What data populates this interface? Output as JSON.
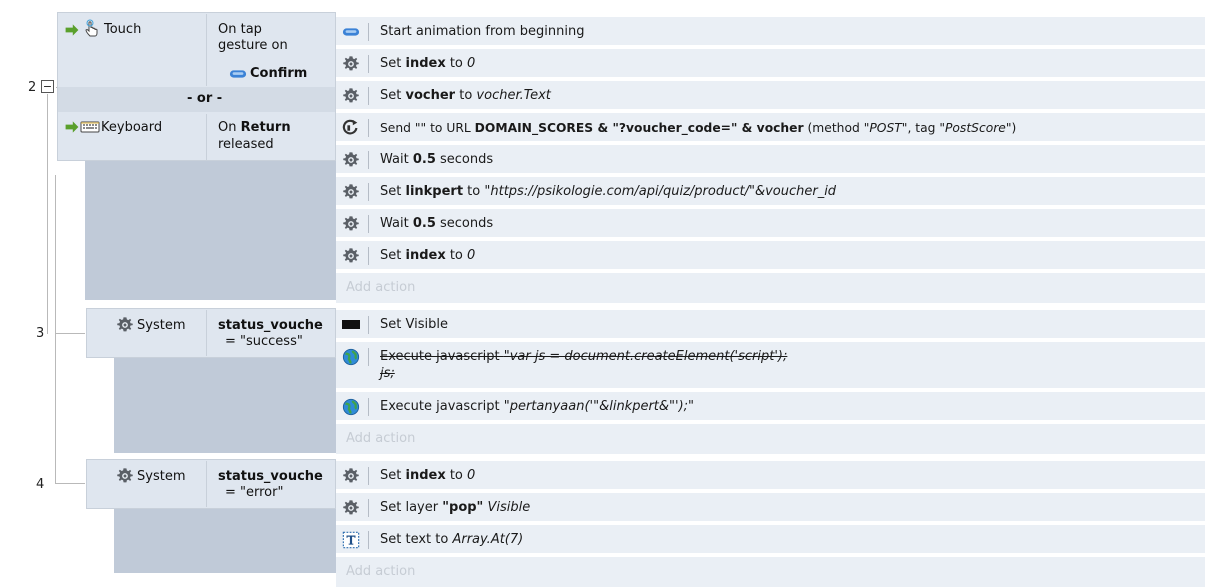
{
  "events": [
    {
      "number": "2",
      "collapse_glyph": "−",
      "conditions": [
        {
          "object": "Touch",
          "icon": "touch-icon",
          "text": "On tap gesture on",
          "target": "Confirm",
          "target_icon": "sprite-button-icon"
        },
        {
          "object": "Keyboard",
          "icon": "keyboard-icon",
          "text_prefix": "On",
          "key": "Return",
          "text_suffix": "released"
        }
      ],
      "or_label": "- or -",
      "actions": [
        {
          "icon": "sprite-button-icon",
          "segments": [
            "Start animation from beginning"
          ]
        },
        {
          "icon": "gear-icon",
          "prefix": "Set ",
          "bold": "index",
          "mid": " to ",
          "italic": "0"
        },
        {
          "icon": "gear-icon",
          "prefix": "Set ",
          "bold": "vocher",
          "mid": " to ",
          "italic": "vocher.Text"
        },
        {
          "icon": "ajax-icon",
          "send_prefix": "Send \"\" to URL ",
          "send_bold": "DOMAIN_SCORES & \"?voucher_code=\" & vocher",
          "send_mid": " (method ",
          "send_method": "\"POST\"",
          "send_tag_label": ", tag ",
          "send_tag": "\"PostScore\"",
          "send_end": ")"
        },
        {
          "icon": "gear-icon",
          "prefix": "Wait ",
          "bold": "0.5",
          "mid": " seconds",
          "italic": ""
        },
        {
          "icon": "gear-icon",
          "prefix": "Set ",
          "bold": "linkpert",
          "mid": " to ",
          "italic": "\"https://psikologie.com/api/quiz/product/\"&voucher_id"
        },
        {
          "icon": "gear-icon",
          "prefix": "Wait ",
          "bold": "0.5",
          "mid": " seconds",
          "italic": ""
        },
        {
          "icon": "gear-icon",
          "prefix": "Set ",
          "bold": "index",
          "mid": " to ",
          "italic": "0"
        }
      ],
      "add_action": "Add action"
    },
    {
      "number": "3",
      "conditions": [
        {
          "object": "System",
          "icon": "gear-icon",
          "bold": "status_vouche",
          "text": "= \"success\""
        }
      ],
      "actions": [
        {
          "icon": "black-rect-icon",
          "prefix": "Set Visible"
        },
        {
          "icon": "browser-icon",
          "prefix": "Execute javascript ",
          "italic": "\"var js = document.createElement('script');",
          "line2": "js;",
          "disabled": true
        },
        {
          "icon": "browser-icon",
          "prefix": "Execute javascript ",
          "italic": "\"pertanyaan('\"&linkpert&\"');\""
        }
      ],
      "add_action": "Add action"
    },
    {
      "number": "4",
      "conditions": [
        {
          "object": "System",
          "icon": "gear-icon",
          "bold": "status_vouche",
          "text": "= \"error\""
        }
      ],
      "actions": [
        {
          "icon": "gear-icon",
          "prefix": "Set ",
          "bold": "index",
          "mid": " to ",
          "italic": "0"
        },
        {
          "icon": "gear-icon",
          "prefix": "Set layer ",
          "bold": "\"pop\"",
          "mid": " ",
          "italic": "Visible"
        },
        {
          "icon": "text-object-icon",
          "prefix": "Set text to ",
          "italic": "Array.At(7)"
        }
      ],
      "add_action": "Add action"
    }
  ],
  "colors": {
    "condition_bg": "#dfe6ef",
    "left_column_bg": "#c0cad8",
    "action_bg": "#eaeff5",
    "add_action_text": "#c6ccd4",
    "arrow_green": "#5aa02c",
    "sprite_blue": "#4a90d9"
  }
}
